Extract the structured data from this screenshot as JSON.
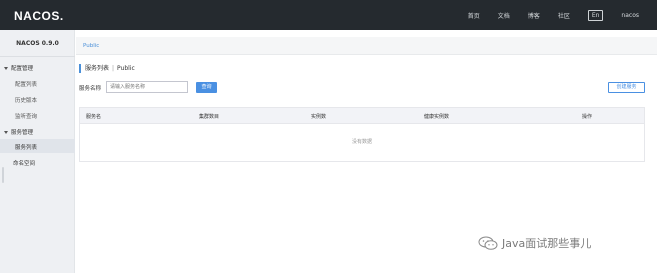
{
  "header": {
    "logo": "NACOS.",
    "nav": [
      "首页",
      "文档",
      "博客",
      "社区"
    ],
    "lang": "En",
    "user": "nacos"
  },
  "sidebar": {
    "version": "NACOS 0.9.0",
    "config_group": "配置管理",
    "config_items": [
      "配置列表",
      "历史版本",
      "监听查询"
    ],
    "service_group": "服务管理",
    "service_items": [
      "服务列表"
    ],
    "namespace": "命名空间"
  },
  "breadcrumb": "Public",
  "page": {
    "title": "服务列表",
    "namespace": "Public"
  },
  "search": {
    "label": "服务名称",
    "placeholder": "请输入服务名称",
    "button": "查询",
    "create_button": "创建服务"
  },
  "table": {
    "columns": [
      "服务名",
      "集群数目",
      "实例数",
      "健康实例数",
      "操作"
    ],
    "empty_text": "没有数据"
  },
  "watermark": {
    "text": "Java面试那些事儿"
  },
  "colors": {
    "topbar": "#252a2f",
    "accent": "#4a90e2",
    "sidebar": "#eef0f3"
  }
}
